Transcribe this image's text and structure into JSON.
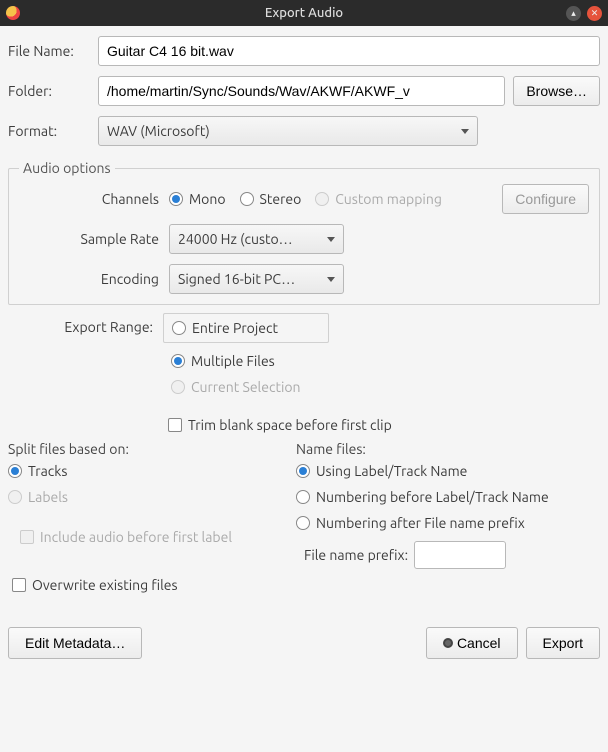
{
  "title": "Export Audio",
  "labels": {
    "file_name": "File Name:",
    "folder": "Folder:",
    "format": "Format:",
    "browse": "Browse…",
    "audio_options": "Audio options",
    "channels": "Channels",
    "mono": "Mono",
    "stereo": "Stereo",
    "custom_mapping": "Custom mapping",
    "configure": "Configure",
    "sample_rate": "Sample Rate",
    "encoding": "Encoding",
    "export_range": "Export Range:",
    "entire_project": "Entire Project",
    "multiple_files": "Multiple Files",
    "current_selection": "Current Selection",
    "trim": "Trim blank space before first clip",
    "split_header": "Split files based on:",
    "tracks": "Tracks",
    "labels_opt": "Labels",
    "include_audio": "Include audio before first label",
    "name_header": "Name files:",
    "using_label": "Using Label/Track Name",
    "num_before": "Numbering before Label/Track Name",
    "num_after": "Numbering after File name prefix",
    "prefix": "File name prefix:",
    "overwrite": "Overwrite existing files",
    "edit_meta": "Edit Metadata…",
    "cancel": "Cancel",
    "export": "Export"
  },
  "values": {
    "file_name": "Guitar C4 16 bit.wav",
    "folder": "/home/martin/Sync/Sounds/Wav/AKWF/AKWF_v",
    "format": "WAV (Microsoft)",
    "sample_rate": "24000 Hz (custo…",
    "encoding": "Signed 16-bit PC…",
    "prefix": ""
  },
  "state": {
    "channels": "mono",
    "export_range": "multiple_files",
    "current_selection_enabled": false,
    "trim": false,
    "split": "tracks",
    "labels_enabled": false,
    "include_audio_enabled": false,
    "name_files": "using_label",
    "overwrite": false
  }
}
